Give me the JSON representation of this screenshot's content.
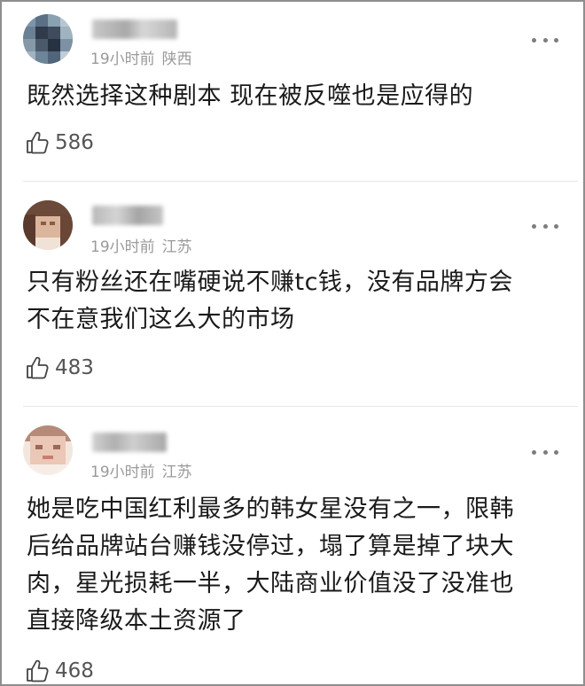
{
  "comments": [
    {
      "time": "19小时前",
      "region": "陕西",
      "text": "既然选择这种剧本  现在被反噬也是应得的",
      "likes": "586",
      "avatar_colors": [
        "#6c8aa0",
        "#2f3a4a",
        "#a9b7c2"
      ]
    },
    {
      "time": "19小时前",
      "region": "江苏",
      "text": "只有粉丝还在嘴硬说不赚tc钱，没有品牌方会\n不在意我们这么大的市场",
      "likes": "483",
      "avatar_colors": [
        "#d9b6a0",
        "#5a3a2c",
        "#f3e3d8"
      ]
    },
    {
      "time": "19小时前",
      "region": "江苏",
      "text": "她是吃中国红利最多的韩女星没有之一，限韩\n后给品牌站台赚钱没停过，塌了算是掉了块大\n肉，星光损耗一半，大陆商业价值没了没准也\n直接降级本土资源了",
      "likes": "468",
      "avatar_colors": [
        "#e8c8b8",
        "#b07a68",
        "#f7ede7"
      ]
    }
  ],
  "icons": {
    "like": "thumbs-up-icon",
    "more": "more-options-icon"
  }
}
